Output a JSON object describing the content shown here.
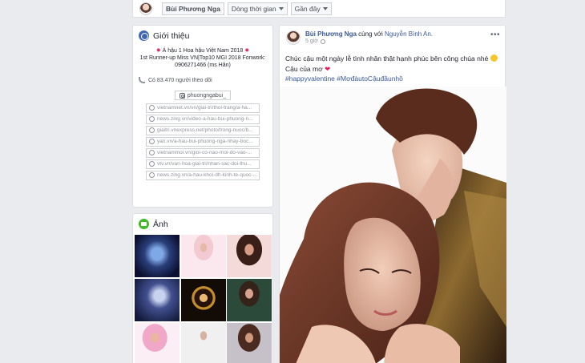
{
  "header": {
    "name": "Bùi Phương Nga",
    "timeline_label": "Dòng thời gian",
    "recent_label": "Gần đây"
  },
  "intro": {
    "title": "Giới thiệu",
    "bio_line1": "Á hậu 1 Hoa hậu Việt Nam 2018",
    "bio_line2": "1st Runner-up Miss VN|Top10 MGI 2018 Fonwork:",
    "bio_line3": "0906271466 (ms Hân)",
    "star_glyph": "✹",
    "followers": "Có 83.470 người theo dõi",
    "instagram": "phuongngabui_",
    "links": [
      "vietnamnet.vn/vn/giai-tri/thoi-trang/a-ha...",
      "news.zing.vn/video-a-hau-bui-phuong-n...",
      "giaitri.vnexpress.net/photo/trong-nuoc/b...",
      "yan.vn/a-hau-bui-phuong-nga-nhay-boc...",
      "vietnammoi.vn/gioi-co-nao-moi-do-vao-...",
      "vtv.vn/van-hoa-giai-tri/nhan-sac-doi-thu...",
      "news.zing.vn/a-hau-khoi-dh-kinh-te-quoc-..."
    ]
  },
  "photos": {
    "title": "Ảnh"
  },
  "post": {
    "author": "Bùi Phương Nga",
    "with_text": "cùng với",
    "tagged": "Nguyễn Bình An.",
    "time": "5 giờ",
    "more_glyph": "•••",
    "text_line1": "Chúc cậu một ngày lễ tình nhân thật hạnh phúc bên công chúa nhé",
    "text_line2": "Cậu của mơ",
    "heart_glyph": "❤",
    "hashtags": "#happyvalentine #MơđàutoCậuđầunhồ"
  }
}
